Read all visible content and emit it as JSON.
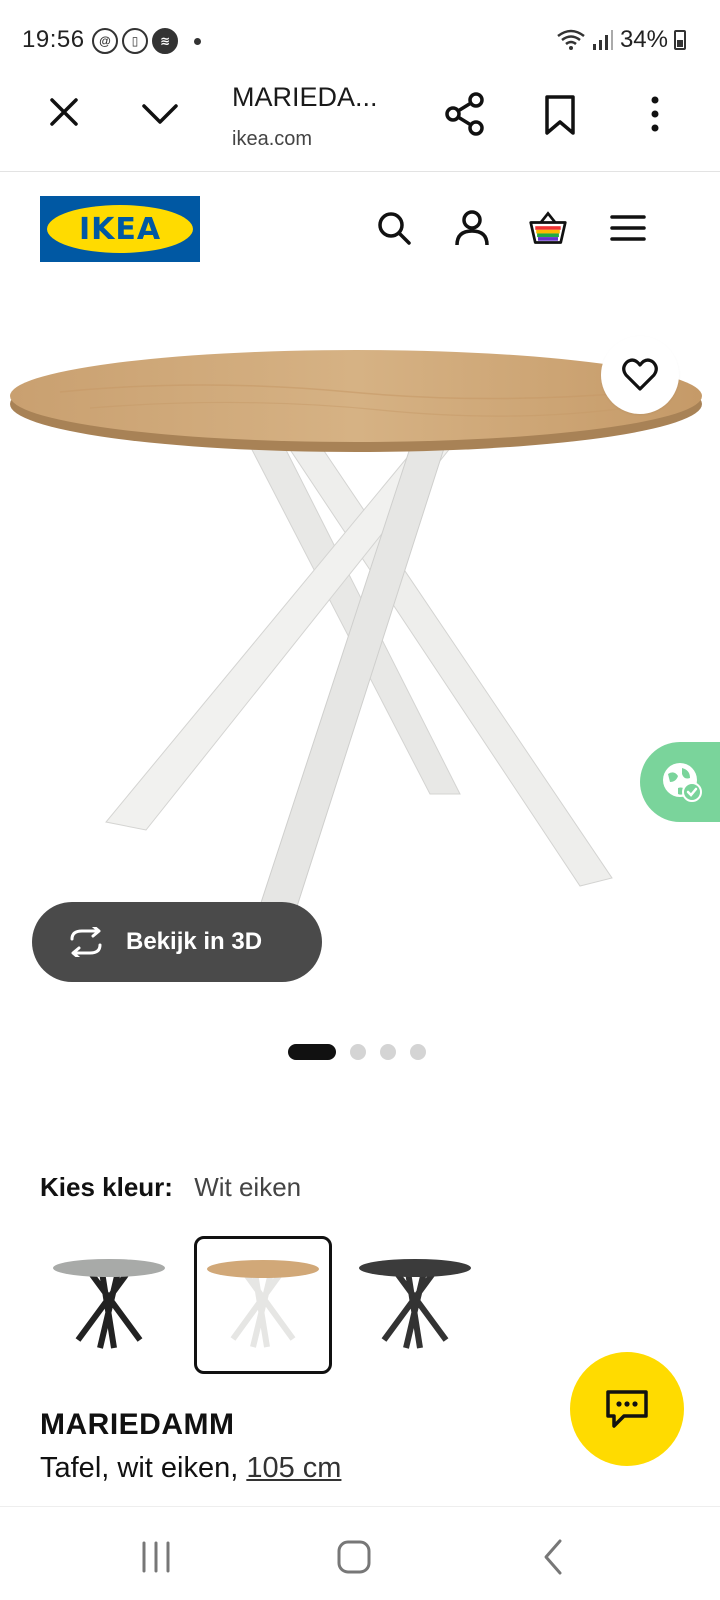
{
  "status_bar": {
    "time": "19:56",
    "battery": "34%",
    "icons": [
      "threads-icon",
      "phone-icon",
      "spotify-icon",
      "dot-icon",
      "wifi-icon",
      "signal-icon",
      "battery-icon"
    ]
  },
  "browser": {
    "title": "MARIEDA...",
    "url": "ikea.com"
  },
  "ikea": {
    "logo_text": "IKEA",
    "brand_blue": "#0058a3",
    "brand_yellow": "#ffdb00"
  },
  "product": {
    "view_3d_label": "Bekijk in 3D",
    "image_count": 4,
    "active_image": 1,
    "color_label": "Kies kleur:",
    "color_value": "Wit eiken",
    "swatches": [
      "grey-top-black-legs",
      "oak-top-white-legs",
      "black-top-black-legs"
    ],
    "selected_swatch": 1,
    "name": "MARIEDAMM",
    "description": "Tafel, wit eiken, ",
    "size": "105 cm"
  },
  "colors": {
    "accent_green": "#7ad49b",
    "button_dark": "#4a4a4a",
    "chat_yellow": "#ffdb00"
  }
}
